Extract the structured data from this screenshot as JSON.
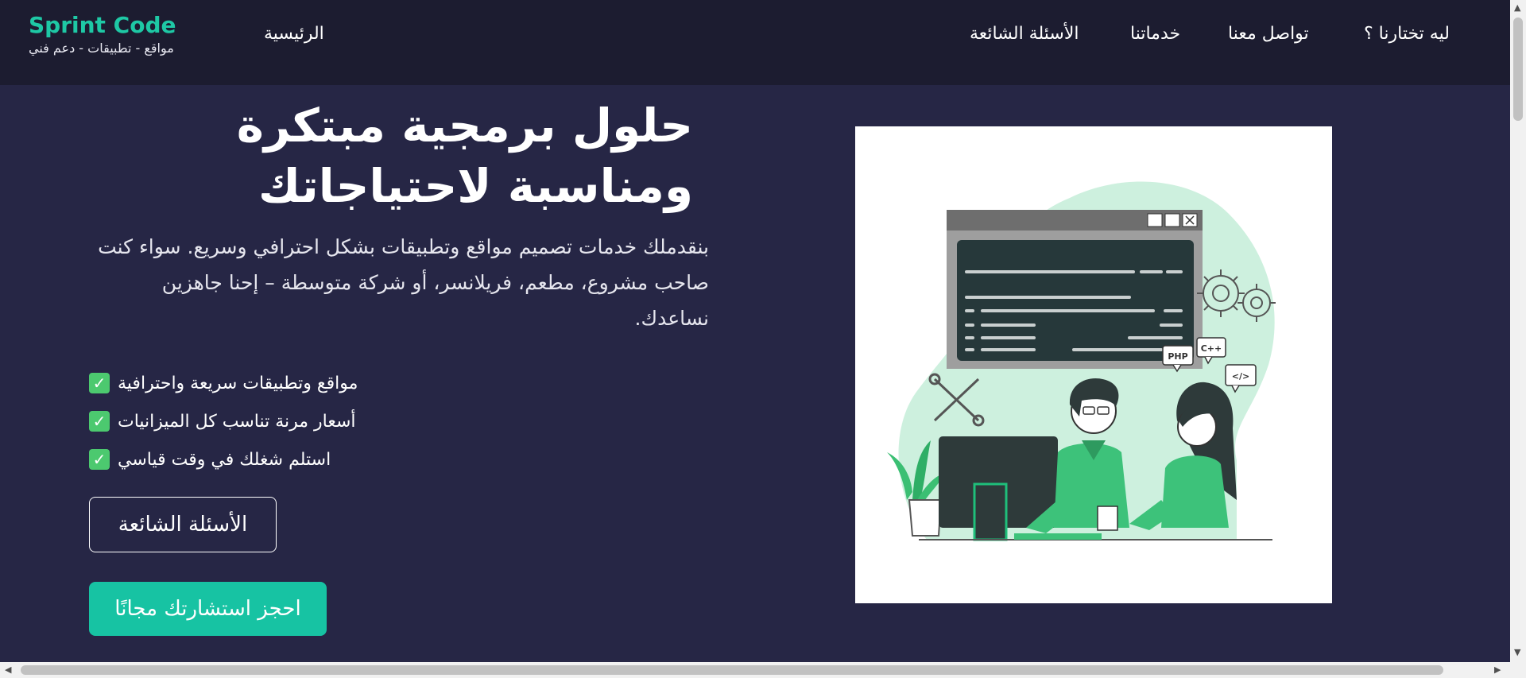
{
  "brand": {
    "title": "Sprint Code",
    "subtitle": "مواقع - تطبيقات - دعم فني"
  },
  "nav": {
    "home": "الرئيسية",
    "why_us": "ليه تختارنا ؟",
    "contact": "تواصل معنا",
    "services": "خدماتنا",
    "faq": "الأسئلة الشائعة"
  },
  "hero": {
    "title": "حلول برمجية مبتكرة ومناسبة لاحتياجاتك",
    "description": "بنقدملك خدمات تصميم مواقع وتطبيقات بشكل احترافي وسريع. سواء كنت صاحب مشروع، مطعم، فريلانسر، أو شركة متوسطة – إحنا جاهزين نساعدك.",
    "features": [
      "مواقع وتطبيقات سريعة واحترافية",
      "أسعار مرنة تناسب كل الميزانيات",
      "استلم شغلك في وقت قياسي"
    ],
    "faq_button": "الأسئلة الشائعة",
    "book_button": "احجز استشارتك مجانًا"
  },
  "illustration": {
    "tag_php": "PHP",
    "tag_cpp": "C++",
    "tag_html": "</>"
  },
  "colors": {
    "accent": "#17c3a3",
    "brand": "#1ec8a5",
    "navbar_bg": "#1c1c30",
    "page_bg": "#262645",
    "check": "#4cc96f"
  }
}
